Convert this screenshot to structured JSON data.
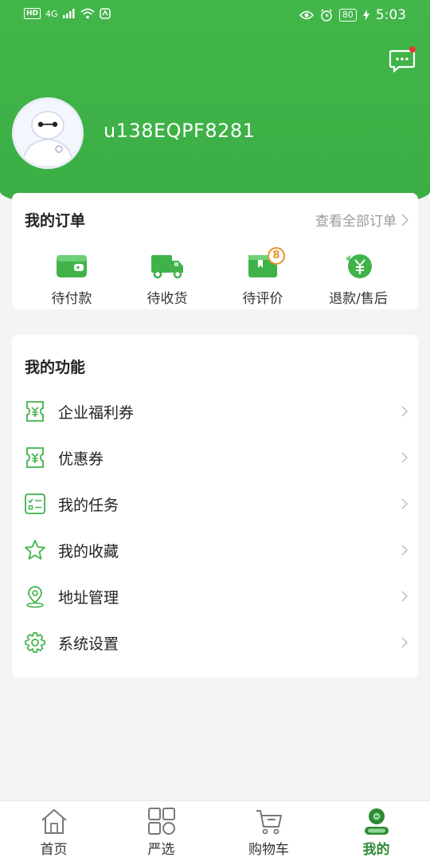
{
  "status_bar": {
    "hd": "HD",
    "signal": "4G",
    "battery": "80",
    "time": "5:03"
  },
  "header": {
    "username": "u138EQPF8281"
  },
  "orders": {
    "title": "我的订单",
    "view_all": "查看全部订单",
    "items": [
      {
        "label": "待付款",
        "icon": "wallet-icon"
      },
      {
        "label": "待收货",
        "icon": "truck-icon"
      },
      {
        "label": "待评价",
        "icon": "review-icon",
        "badge": "8"
      },
      {
        "label": "退款/售后",
        "icon": "refund-icon"
      }
    ]
  },
  "functions": {
    "title": "我的功能",
    "items": [
      {
        "label": "企业福利券",
        "icon": "coupon-icon"
      },
      {
        "label": "优惠券",
        "icon": "coupon-icon"
      },
      {
        "label": "我的任务",
        "icon": "task-list-icon"
      },
      {
        "label": "我的收藏",
        "icon": "star-icon"
      },
      {
        "label": "地址管理",
        "icon": "location-pin-icon"
      },
      {
        "label": "系统设置",
        "icon": "gear-icon"
      }
    ]
  },
  "tabbar": {
    "items": [
      {
        "label": "首页",
        "icon": "home-icon"
      },
      {
        "label": "严选",
        "icon": "grid-icon"
      },
      {
        "label": "购物车",
        "icon": "cart-icon"
      },
      {
        "label": "我的",
        "icon": "profile-icon",
        "active": true
      }
    ]
  },
  "colors": {
    "brand_green": "#3aae46",
    "badge_orange": "#e6962e",
    "notice_red": "#e53935"
  }
}
